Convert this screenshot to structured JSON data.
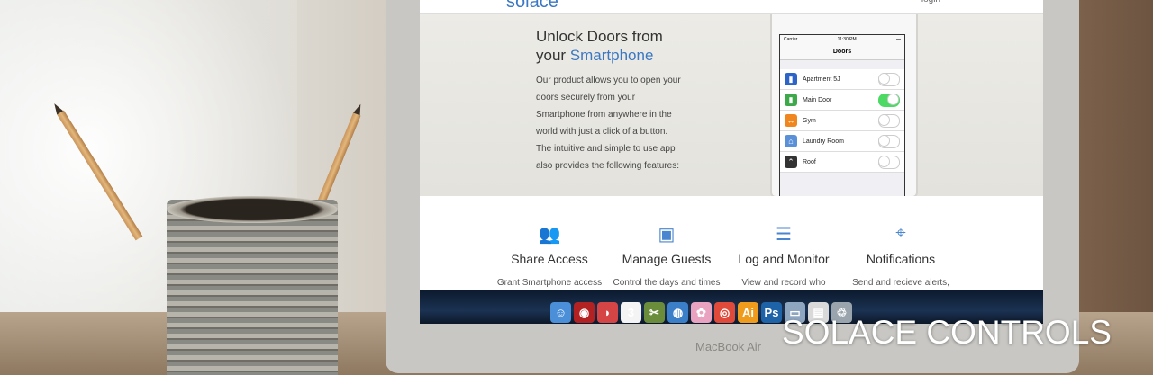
{
  "website": {
    "logo": "solace",
    "login_label": "login",
    "hero": {
      "title_line1": "Unlock Doors from",
      "title_line2_prefix": "your ",
      "title_line2_highlight": "Smartphone",
      "body": "Our product allows you to open your doors securely from your Smartphone from anywhere in the world with just a click of a button. The intuitive and simple to use app also provides the following features:"
    },
    "phone": {
      "carrier": "Carrier",
      "time": "11:30 PM",
      "nav_title": "Doors",
      "doors": [
        {
          "label": "Apartment 5J",
          "icon": "door-icon",
          "color": "#2c64c8",
          "enabled": false
        },
        {
          "label": "Main Door",
          "icon": "door-icon",
          "color": "#3da94a",
          "enabled": true
        },
        {
          "label": "Gym",
          "icon": "dumbbell-icon",
          "color": "#f0861e",
          "enabled": false
        },
        {
          "label": "Laundry Room",
          "icon": "laundry-icon",
          "color": "#5a90d8",
          "enabled": false
        },
        {
          "label": "Roof",
          "icon": "roof-icon",
          "color": "#333333",
          "enabled": false
        }
      ]
    },
    "features": [
      {
        "title": "Share Access",
        "desc": "Grant Smartphone access",
        "icon": "users-icon"
      },
      {
        "title": "Manage Guests",
        "desc": "Control the days and times",
        "icon": "id-card-icon"
      },
      {
        "title": "Log and Monitor",
        "desc": "View and record who",
        "icon": "list-icon"
      },
      {
        "title": "Notifications",
        "desc": "Send and recieve alerts,",
        "icon": "map-pin-icon"
      }
    ]
  },
  "dock": {
    "apps": [
      {
        "name": "finder-icon",
        "glyph": "☺",
        "color": "#4a8fd8"
      },
      {
        "name": "dvd-player-icon",
        "glyph": "◉",
        "color": "#b22222"
      },
      {
        "name": "watermelon-icon",
        "glyph": "◗",
        "color": "#d64545"
      },
      {
        "name": "calendar-icon",
        "glyph": "3",
        "color": "#f4f4f4"
      },
      {
        "name": "tools-icon",
        "glyph": "✂",
        "color": "#6b8c3a"
      },
      {
        "name": "globe-icon",
        "glyph": "◍",
        "color": "#3c7fc9"
      },
      {
        "name": "flower-icon",
        "glyph": "✿",
        "color": "#e9a3c0"
      },
      {
        "name": "chrome-icon",
        "glyph": "◎",
        "color": "#e04a3a"
      },
      {
        "name": "illustrator-icon",
        "glyph": "Ai",
        "color": "#ef9b1c"
      },
      {
        "name": "photoshop-icon",
        "glyph": "Ps",
        "color": "#1e62a8"
      },
      {
        "name": "folder-icon",
        "glyph": "▭",
        "color": "#8fa6c0"
      },
      {
        "name": "document-icon",
        "glyph": "▤",
        "color": "#d9d9d9"
      },
      {
        "name": "trash-icon",
        "glyph": "♲",
        "color": "#9aa4ad"
      }
    ]
  },
  "laptop_label": "MacBook Air",
  "caption": "SOLACE CONTROLS"
}
